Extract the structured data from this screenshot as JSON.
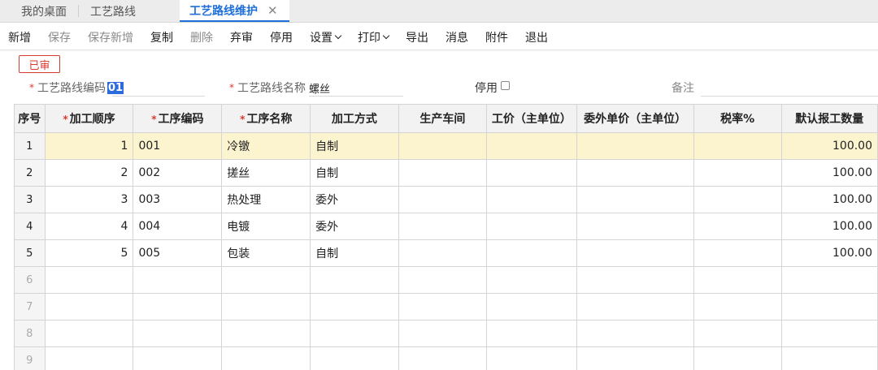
{
  "tabs": {
    "home": "我的桌面",
    "routes": "工艺路线",
    "active": "工艺路线维护",
    "close_glyph": "✕"
  },
  "toolbar": {
    "add": "新增",
    "save": "保存",
    "save_add": "保存新增",
    "copy": "复制",
    "delete": "删除",
    "abandon": "弃审",
    "disable": "停用",
    "settings": "设置",
    "print": "打印",
    "export": "导出",
    "message": "消息",
    "attachment": "附件",
    "exit": "退出"
  },
  "status_badge": "已审",
  "form": {
    "required_mark": "*",
    "code_label": "工艺路线编码",
    "code_value": "01",
    "name_label": "工艺路线名称",
    "name_value": "螺丝",
    "disabled_label": "停用",
    "remark_label": "备注"
  },
  "grid": {
    "headers": {
      "index": "序号",
      "seq": "加工顺序",
      "op_code": "工序编码",
      "op_name": "工序名称",
      "method": "加工方式",
      "workshop": "生产车间",
      "labor_price": "工价（主单位）",
      "outsource_price": "委外单价（主单位）",
      "tax_rate": "税率%",
      "default_qty": "默认报工数量"
    },
    "rows": [
      {
        "index": "1",
        "seq": "1",
        "op_code": "001",
        "op_name": "冷镦",
        "method": "自制",
        "default_qty": "100.00"
      },
      {
        "index": "2",
        "seq": "2",
        "op_code": "002",
        "op_name": "搓丝",
        "method": "自制",
        "default_qty": "100.00"
      },
      {
        "index": "3",
        "seq": "3",
        "op_code": "003",
        "op_name": "热处理",
        "method": "委外",
        "default_qty": "100.00"
      },
      {
        "index": "4",
        "seq": "4",
        "op_code": "004",
        "op_name": "电镀",
        "method": "委外",
        "default_qty": "100.00"
      },
      {
        "index": "5",
        "seq": "5",
        "op_code": "005",
        "op_name": "包装",
        "method": "自制",
        "default_qty": "100.00"
      },
      {
        "index": "6"
      },
      {
        "index": "7"
      },
      {
        "index": "8"
      },
      {
        "index": "9"
      }
    ]
  },
  "colors": {
    "accent": "#1e6fd9",
    "status_red": "#d63b2e",
    "selected_row": "#fcf3cf"
  }
}
